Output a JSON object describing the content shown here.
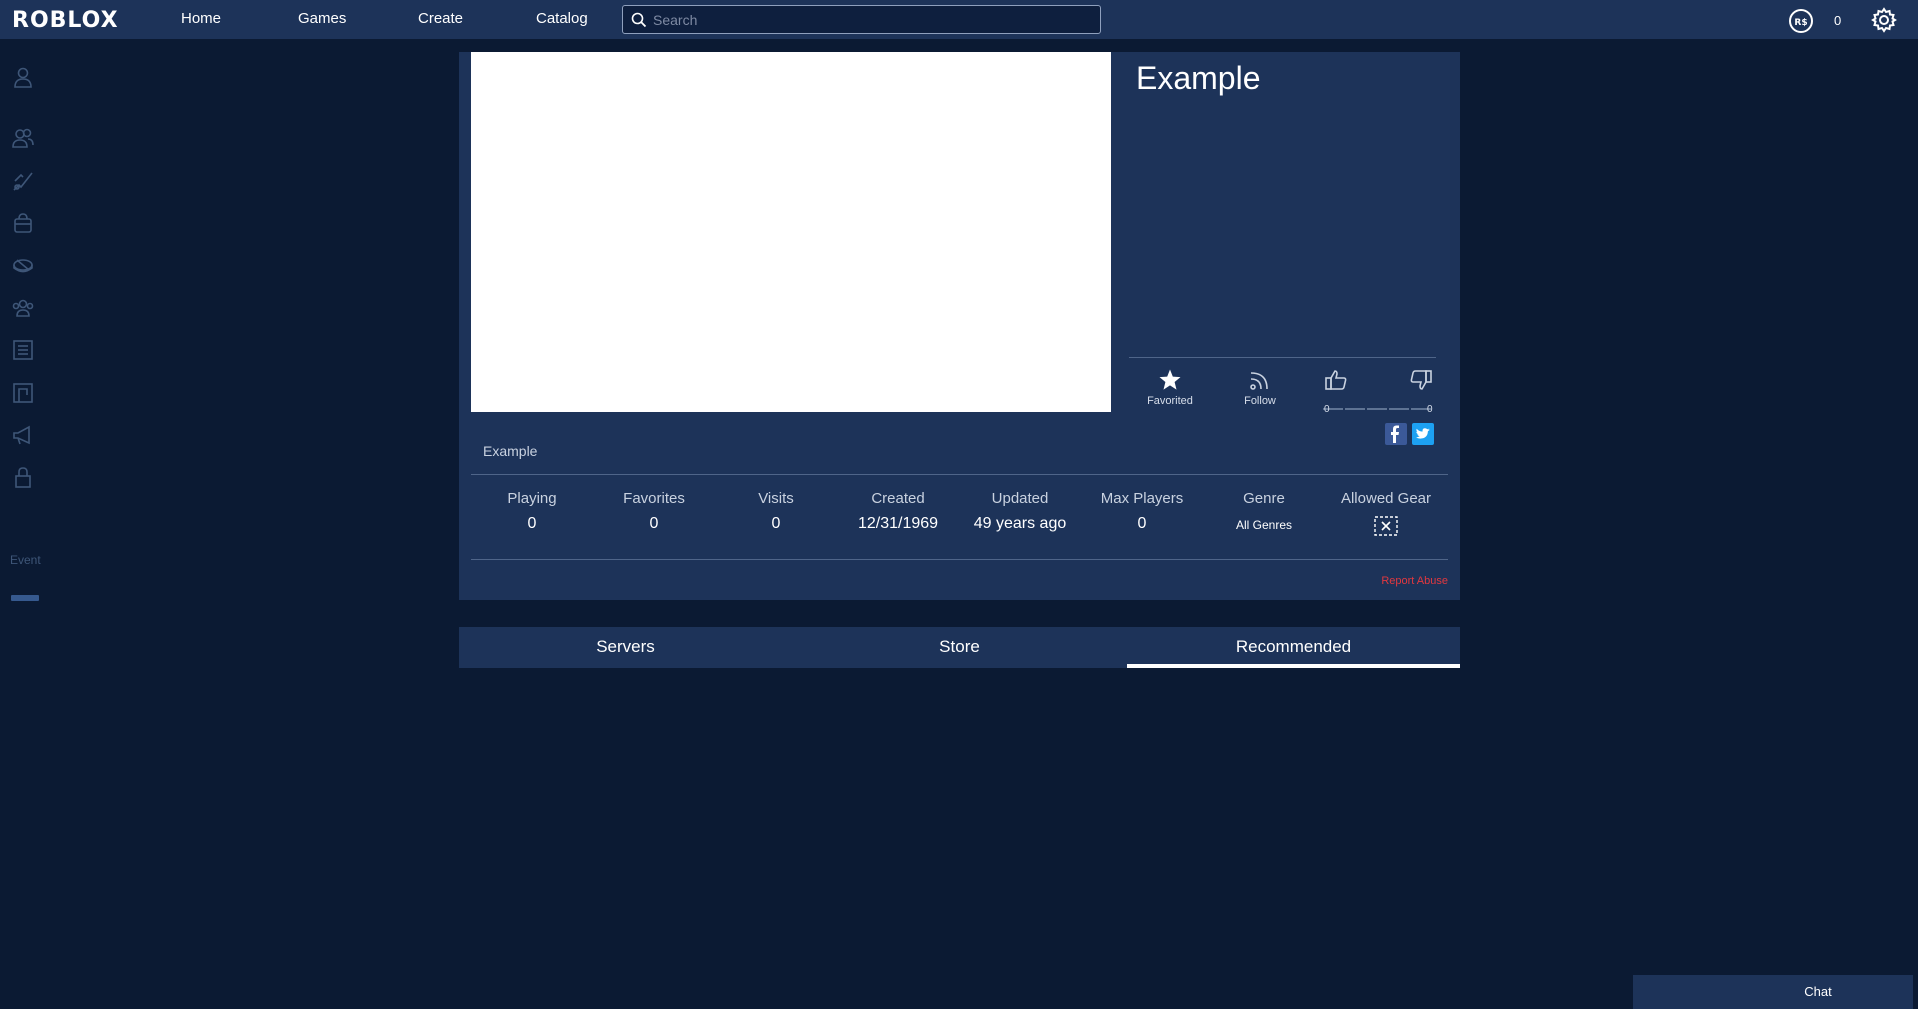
{
  "header": {
    "logo": "ROBLOX",
    "nav": [
      "Home",
      "Games",
      "Create",
      "Catalog"
    ],
    "search_placeholder": "Search",
    "robux": "0"
  },
  "sidebar": {
    "icons": [
      "profile-icon",
      "friends-icon",
      "avatar-icon",
      "inventory-icon",
      "trade-icon",
      "groups-icon",
      "blog-icon",
      "merchandise-icon",
      "megaphone-icon",
      "lock-icon"
    ],
    "events_label": "Event"
  },
  "game": {
    "title": "Example",
    "description": "Example",
    "actions": {
      "favorite_label": "Favorited",
      "follow_label": "Follow",
      "upvotes": "0",
      "downvotes": "0"
    },
    "stats": [
      {
        "label": "Playing",
        "value": "0"
      },
      {
        "label": "Favorites",
        "value": "0"
      },
      {
        "label": "Visits",
        "value": "0"
      },
      {
        "label": "Created",
        "value": "12/31/1969"
      },
      {
        "label": "Updated",
        "value": "49 years ago"
      },
      {
        "label": "Max Players",
        "value": "0"
      },
      {
        "label": "Genre",
        "value": "All Genres"
      },
      {
        "label": "Allowed Gear",
        "value": ""
      }
    ],
    "report_abuse": "Report Abuse"
  },
  "tabs": {
    "items": [
      "Servers",
      "Store",
      "Recommended"
    ],
    "active": "Recommended"
  },
  "chat": {
    "label": "Chat"
  },
  "colors": {
    "background": "#0b1a33",
    "panel": "#1d3359",
    "report_red": "#e2383f",
    "facebook": "#3b5998",
    "twitter": "#1da1f2"
  }
}
